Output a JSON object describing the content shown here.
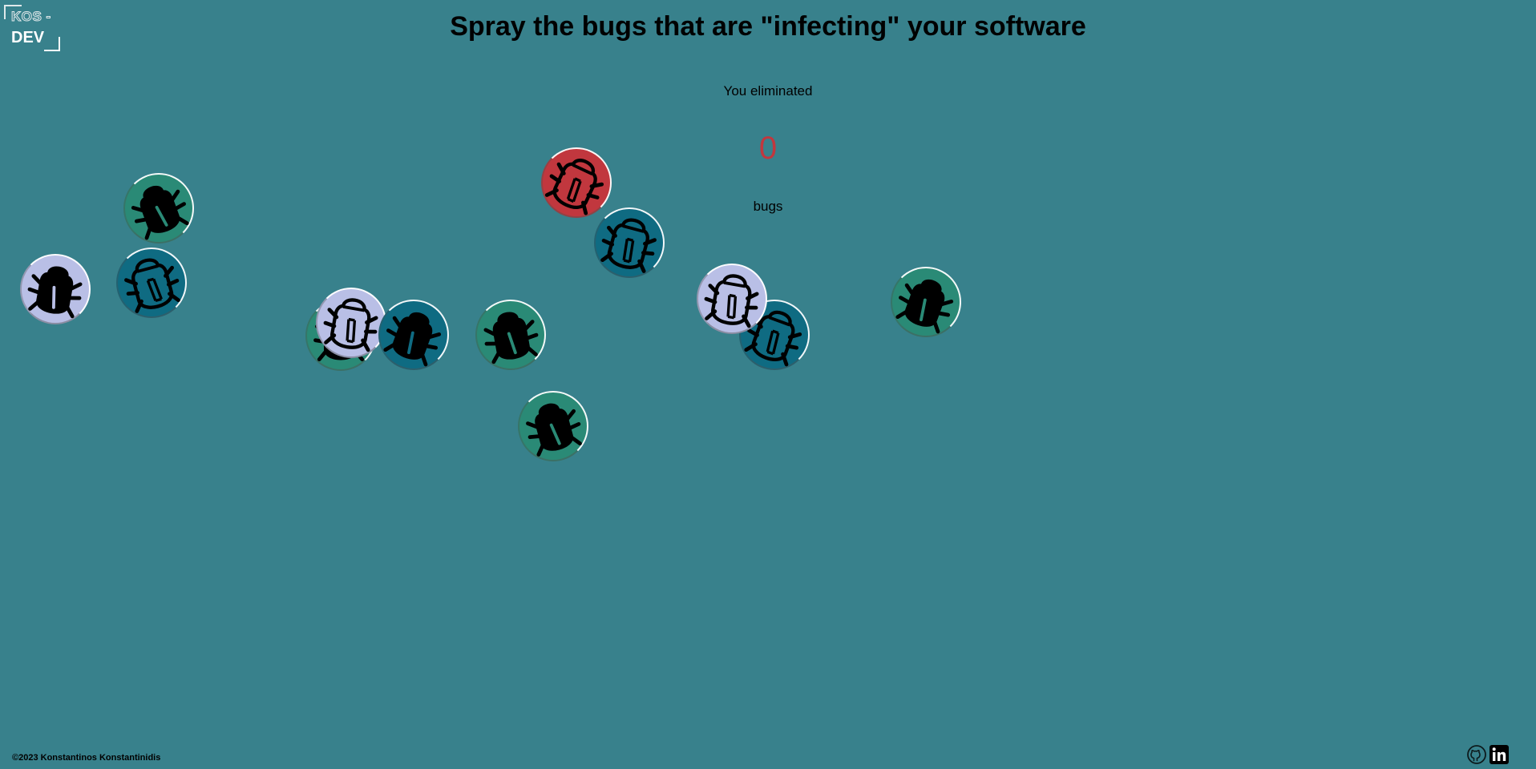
{
  "logo": {
    "top": "KOS -",
    "bottom": "DEV"
  },
  "header": {
    "title": "Spray the bugs that are \"infecting\" your software"
  },
  "score": {
    "prefix": "You eliminated",
    "value": "0",
    "suffix": "bugs"
  },
  "colors": {
    "background": "#38818c",
    "green": "#2a8a76",
    "blue": "#0f6b82",
    "lavender": "#b9bfe6",
    "red": "#c1373e",
    "score": "#c1373e"
  },
  "bugs": [
    {
      "color": "green",
      "style": "filled"
    },
    {
      "color": "lavender",
      "style": "filled"
    },
    {
      "color": "blue",
      "style": "outline"
    },
    {
      "color": "green",
      "style": "filled"
    },
    {
      "color": "lavender",
      "style": "outline"
    },
    {
      "color": "blue",
      "style": "filled"
    },
    {
      "color": "green",
      "style": "filled"
    },
    {
      "color": "green",
      "style": "filled"
    },
    {
      "color": "red",
      "style": "outline"
    },
    {
      "color": "blue",
      "style": "outline"
    },
    {
      "color": "blue",
      "style": "outline"
    },
    {
      "color": "lavender",
      "style": "outline"
    },
    {
      "color": "green",
      "style": "filled"
    }
  ],
  "footer": {
    "copyright": "©2023 Konstantinos Konstantinidis",
    "social": [
      "github-icon",
      "linkedin-icon"
    ]
  }
}
